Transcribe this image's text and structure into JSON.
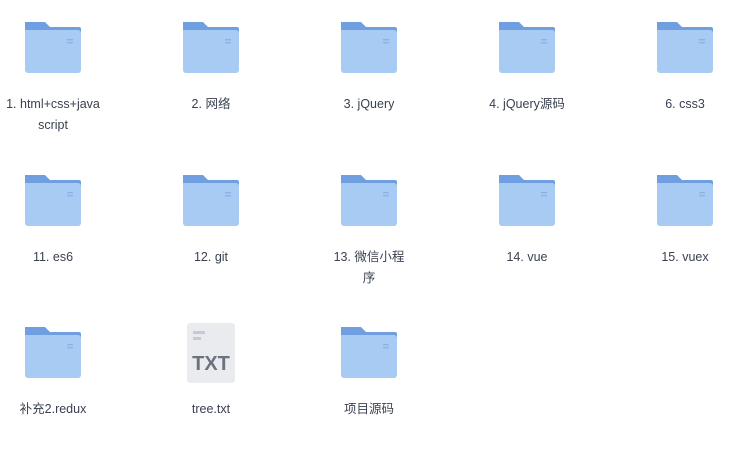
{
  "items": [
    {
      "name": "1. html+css+javascript",
      "type": "folder"
    },
    {
      "name": "2. 网络",
      "type": "folder"
    },
    {
      "name": "3. jQuery",
      "type": "folder"
    },
    {
      "name": "4. jQuery源码",
      "type": "folder"
    },
    {
      "name": "6. css3",
      "type": "folder"
    },
    {
      "name": "11. es6",
      "type": "folder"
    },
    {
      "name": "12. git",
      "type": "folder"
    },
    {
      "name": "13. 微信小程序",
      "type": "folder"
    },
    {
      "name": "14. vue",
      "type": "folder"
    },
    {
      "name": "15. vuex",
      "type": "folder"
    },
    {
      "name": "补充2.redux",
      "type": "folder"
    },
    {
      "name": "tree.txt",
      "type": "txt-file",
      "icon_text": "TXT"
    },
    {
      "name": "项目源码",
      "type": "folder"
    }
  ],
  "colors": {
    "folder_back": "#7aaee8",
    "folder_front": "#a9cdf5",
    "txt_bg": "#ebedf0",
    "txt_text": "#6b7380"
  }
}
